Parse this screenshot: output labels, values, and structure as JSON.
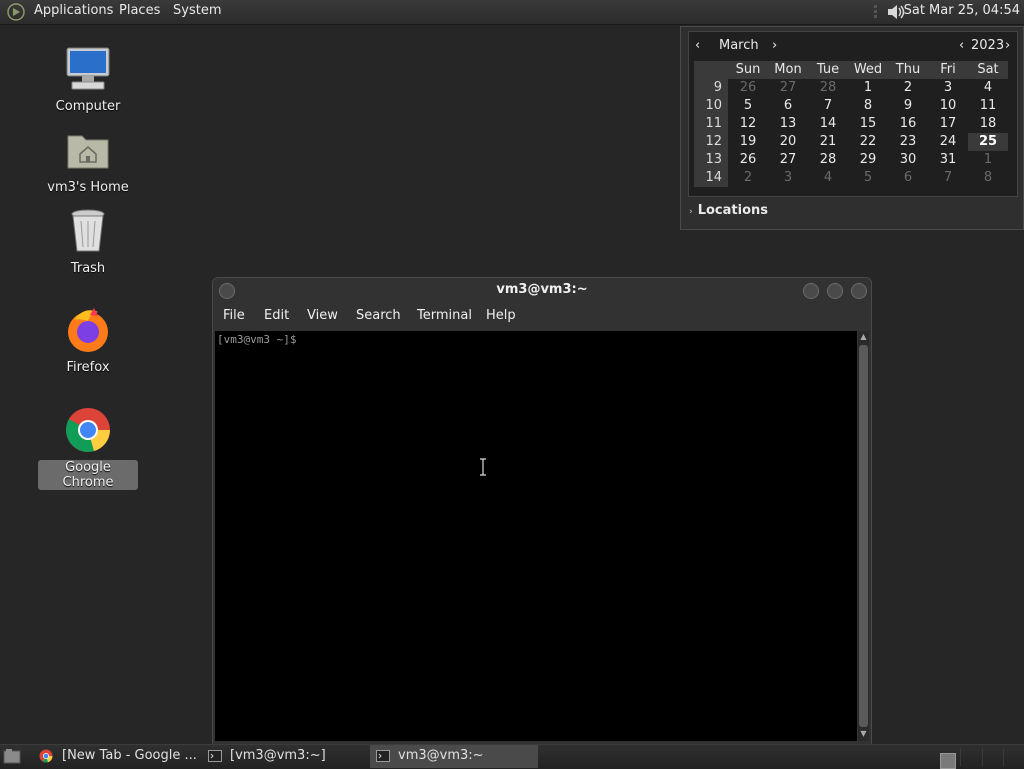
{
  "top_panel": {
    "menus": [
      "Applications",
      "Places",
      "System"
    ],
    "clock": "Sat Mar 25, 04:54"
  },
  "desktop": {
    "icons": [
      {
        "label": "Computer"
      },
      {
        "label": "vm3's Home"
      },
      {
        "label": "Trash"
      },
      {
        "label": "Firefox"
      },
      {
        "label": "Google Chrome"
      }
    ]
  },
  "calendar": {
    "month": "March",
    "year": "2023",
    "headers": [
      "Sun",
      "Mon",
      "Tue",
      "Wed",
      "Thu",
      "Fri",
      "Sat"
    ],
    "weeks": [
      {
        "week": "9",
        "days": [
          "26",
          "27",
          "28",
          "1",
          "2",
          "3",
          "4"
        ]
      },
      {
        "week": "10",
        "days": [
          "5",
          "6",
          "7",
          "8",
          "9",
          "10",
          "11"
        ]
      },
      {
        "week": "11",
        "days": [
          "12",
          "13",
          "14",
          "15",
          "16",
          "17",
          "18"
        ]
      },
      {
        "week": "12",
        "days": [
          "19",
          "20",
          "21",
          "22",
          "23",
          "24",
          "25"
        ]
      },
      {
        "week": "13",
        "days": [
          "26",
          "27",
          "28",
          "29",
          "30",
          "31",
          "1"
        ]
      },
      {
        "week": "14",
        "days": [
          "2",
          "3",
          "4",
          "5",
          "6",
          "7",
          "8"
        ]
      }
    ],
    "today": "25",
    "locations_label": "Locations"
  },
  "terminal": {
    "title": "vm3@vm3:~",
    "menus": [
      "File",
      "Edit",
      "View",
      "Search",
      "Terminal",
      "Help"
    ],
    "prompt": "[vm3@vm3 ~]$"
  },
  "taskbar": {
    "tasks": [
      {
        "label": "[New Tab - Google ...",
        "icon": "chrome-icon",
        "active": false
      },
      {
        "label": "[vm3@vm3:~]",
        "icon": "terminal-icon",
        "active": false
      },
      {
        "label": "vm3@vm3:~",
        "icon": "terminal-icon",
        "active": true
      }
    ]
  }
}
